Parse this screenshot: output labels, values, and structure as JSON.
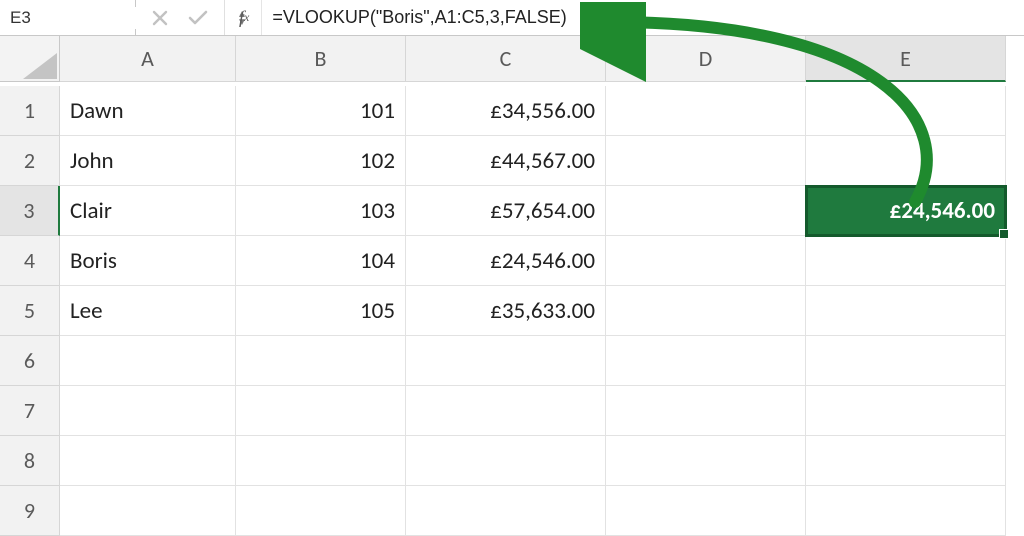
{
  "formula_bar": {
    "name_box": "E3",
    "fx_label": "fx",
    "formula": "=VLOOKUP(\"Boris\",A1:C5,3,FALSE)"
  },
  "columns": [
    "A",
    "B",
    "C",
    "D",
    "E"
  ],
  "rows": [
    "1",
    "2",
    "3",
    "4",
    "5",
    "6",
    "7",
    "8",
    "9"
  ],
  "active_column": "E",
  "active_row": "3",
  "selected_cell": {
    "row": 3,
    "col": "E",
    "display": "£24,546.00"
  },
  "data": {
    "A": [
      "Dawn",
      "John",
      "Clair",
      "Boris",
      "Lee"
    ],
    "B": [
      "101",
      "102",
      "103",
      "104",
      "105"
    ],
    "C": [
      "£34,556.00",
      "£44,567.00",
      "£57,654.00",
      "£24,546.00",
      "£35,633.00"
    ]
  },
  "annotation": {
    "arrow_color": "#1f8a2e"
  }
}
